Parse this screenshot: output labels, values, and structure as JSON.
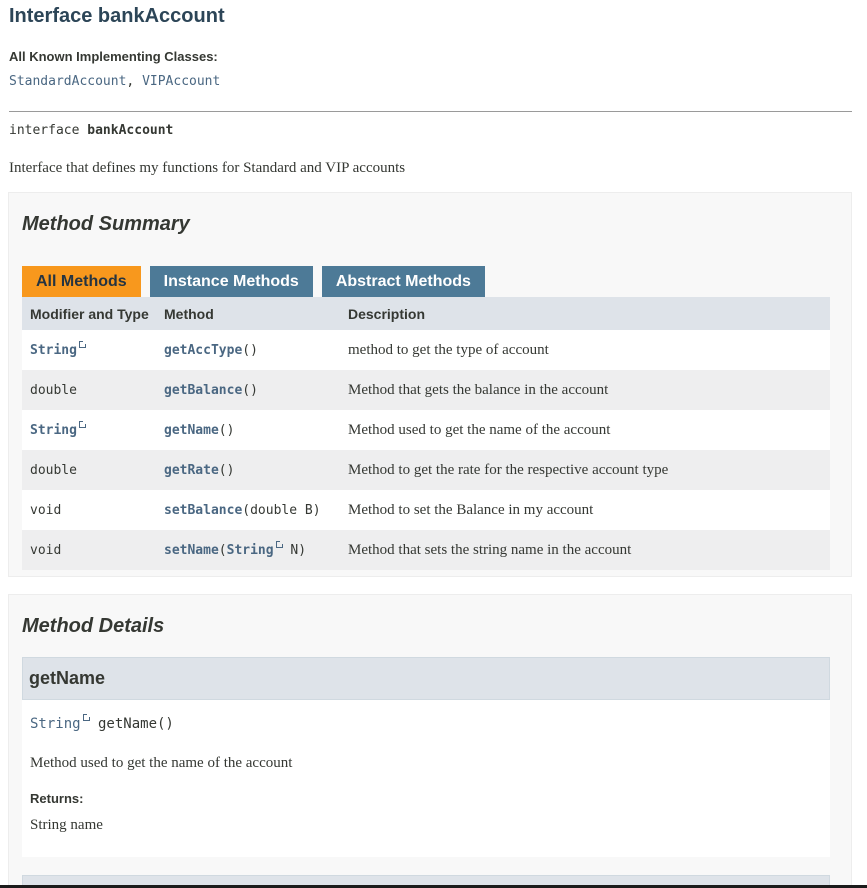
{
  "header": {
    "title": "Interface bankAccount",
    "known_label": "All Known Implementing Classes:",
    "known_classes": [
      "StandardAccount",
      "VIPAccount"
    ],
    "known_separator": ", ",
    "signature_keyword": "interface",
    "signature_name": "bankAccount",
    "description": "Interface that defines my functions for Standard and VIP accounts"
  },
  "summary": {
    "heading": "Method Summary",
    "tabs": [
      {
        "label": "All Methods",
        "active": true
      },
      {
        "label": "Instance Methods",
        "active": false
      },
      {
        "label": "Abstract Methods",
        "active": false
      }
    ],
    "columns": [
      "Modifier and Type",
      "Method",
      "Description"
    ],
    "rows": [
      {
        "type": "String",
        "type_link": true,
        "method": "getAccType",
        "params_pre": "()",
        "param_link": "",
        "params_post": "",
        "desc": "method to get the type of account"
      },
      {
        "type": "double",
        "type_link": false,
        "method": "getBalance",
        "params_pre": "()",
        "param_link": "",
        "params_post": "",
        "desc": "Method that gets the balance in the account"
      },
      {
        "type": "String",
        "type_link": true,
        "method": "getName",
        "params_pre": "()",
        "param_link": "",
        "params_post": "",
        "desc": "Method used to get the name of the account"
      },
      {
        "type": "double",
        "type_link": false,
        "method": "getRate",
        "params_pre": "()",
        "param_link": "",
        "params_post": "",
        "desc": "Method to get the rate for the respective account type"
      },
      {
        "type": "void",
        "type_link": false,
        "method": "setBalance",
        "params_pre": "(double B)",
        "param_link": "",
        "params_post": "",
        "desc": "Method to set the Balance in my account"
      },
      {
        "type": "void",
        "type_link": false,
        "method": "setName",
        "params_pre": "(",
        "param_link": "String",
        "params_post": " N)",
        "desc": "Method that sets the string name in the account"
      }
    ]
  },
  "details": {
    "heading": "Method Details",
    "method_name": "getName",
    "sig_type": "String",
    "sig_rest": " getName()",
    "description": "Method used to get the name of the account",
    "returns_label": "Returns:",
    "returns_value": "String name"
  },
  "colors": {
    "accent_active_tab": "#f8981d",
    "tab": "#4d7a97",
    "link": "#4a6782",
    "title": "#2c4557",
    "table_header": "#dee3e9"
  },
  "icons": {
    "external_link": "external-link-icon"
  }
}
